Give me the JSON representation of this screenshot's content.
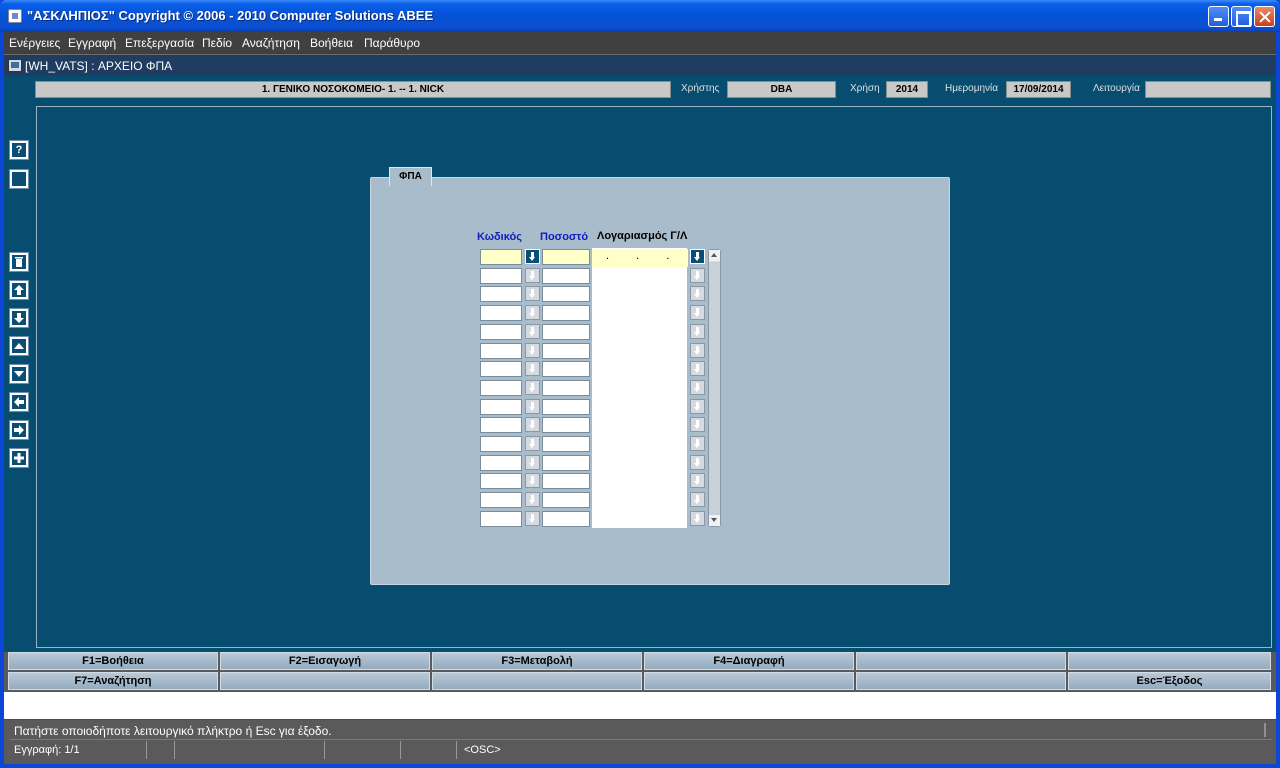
{
  "window": {
    "title": "\"ΑΣΚΛΗΠΙΟΣ\" Copyright © 2006 - 2010 Computer Solutions ABEE"
  },
  "menu": {
    "items": [
      "Ενέργειες",
      "Εγγραφή",
      "Επεξεργασία",
      "Πεδίο",
      "Αναζήτηση",
      "Βοήθεια",
      "Παράθυρο"
    ]
  },
  "document": {
    "title": "[WH_VATS]   :  ΑΡΧΕΙΟ ΦΠΑ"
  },
  "info": {
    "hospital": "1. ΓΕΝΙΚΟ ΝΟΣΟΚΟΜΕΙΟ- 1. -- 1. NICK",
    "user_label": "Χρήστης",
    "user_value": "DBA",
    "year_label": "Χρήση",
    "year_value": "2014",
    "date_label": "Ημερομηνία",
    "date_value": "17/09/2014",
    "function_label": "Λειτουργία",
    "function_value": ""
  },
  "toolbar": {
    "help_glyph": "?",
    "items": [
      "help",
      "book",
      "delete",
      "first-record",
      "last-record",
      "previous-record",
      "next-record",
      "previous-block",
      "next-block",
      "insert"
    ]
  },
  "form": {
    "tab_label": "ΦΠΑ",
    "col_code": "Κωδικός",
    "col_percent": "Ποσοστό",
    "col_account": "Λογαριασμός Γ/Λ",
    "account_mask": ". . . .",
    "row_count": 15
  },
  "fkeys": {
    "row1": [
      "F1=Βοήθεια",
      "F2=Εισαγωγή",
      "F3=Μεταβολή",
      "F4=Διαγραφή",
      "",
      ""
    ],
    "row2": [
      "F7=Αναζήτηση",
      "",
      "",
      "",
      "",
      "Esc=Έξοδος"
    ]
  },
  "status": {
    "message": "Πατήστε οποιοδήποτε λειτουργικό πλήκτρο ή Esc για έξοδο.",
    "record": "Εγγραφή: 1/1",
    "mode": "<OSC>"
  }
}
